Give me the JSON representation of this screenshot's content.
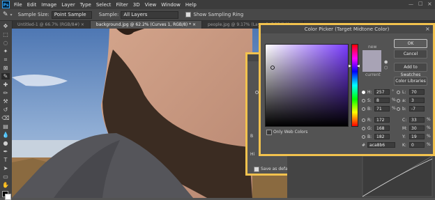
{
  "menu": [
    "Ps",
    "File",
    "Edit",
    "Image",
    "Layer",
    "Type",
    "Select",
    "Filter",
    "3D",
    "View",
    "Window",
    "Help"
  ],
  "options": {
    "sample_size_label": "Sample Size:",
    "sample_size_value": "Point Sample",
    "sample_label": "Sample:",
    "sample_value": "All Layers",
    "show_ring_label": "Show Sampling Ring"
  },
  "tabs": [
    {
      "label": "Untitled-1 @ 66.7% (RGB/8#) ×",
      "active": false
    },
    {
      "label": "background.jpg @ 62.2% (Curves 1, RGB/8) * ×",
      "active": true
    },
    {
      "label": "people.jpg @ 9.17% (Layer 1, RGB/8#) * ×",
      "active": false
    }
  ],
  "curves_dialog": {
    "save_defaults_label": "Save as defaults",
    "side_labels": [
      "B",
      "Hi"
    ]
  },
  "color_picker": {
    "title": "Color Picker (Target Midtone Color)",
    "new_label": "new",
    "current_label": "current",
    "new_color": "#a8a3b5",
    "current_color": "#a8a3b5",
    "hue_color": "#7a3cff",
    "only_web_colors_label": "Only Web Colors",
    "buttons": {
      "ok": "OK",
      "cancel": "Cancel",
      "add_swatches": "Add to Swatches",
      "color_libraries": "Color Libraries"
    },
    "fields": {
      "h": {
        "label": "H:",
        "value": "257",
        "unit": "°"
      },
      "s": {
        "label": "S:",
        "value": "8",
        "unit": "%"
      },
      "b": {
        "label": "B:",
        "value": "71",
        "unit": "%"
      },
      "r": {
        "label": "R:",
        "value": "172"
      },
      "g": {
        "label": "G:",
        "value": "168"
      },
      "bl": {
        "label": "B:",
        "value": "182"
      },
      "l": {
        "label": "L:",
        "value": "70"
      },
      "a": {
        "label": "a:",
        "value": "3"
      },
      "b2": {
        "label": "b:",
        "value": "-7"
      },
      "c": {
        "label": "C:",
        "value": "33",
        "unit": "%"
      },
      "m": {
        "label": "M:",
        "value": "30",
        "unit": "%"
      },
      "y": {
        "label": "Y:",
        "value": "19",
        "unit": "%"
      },
      "k": {
        "label": "K:",
        "value": "0",
        "unit": "%"
      },
      "hex": {
        "label": "#",
        "value": "aca8b6"
      }
    }
  }
}
